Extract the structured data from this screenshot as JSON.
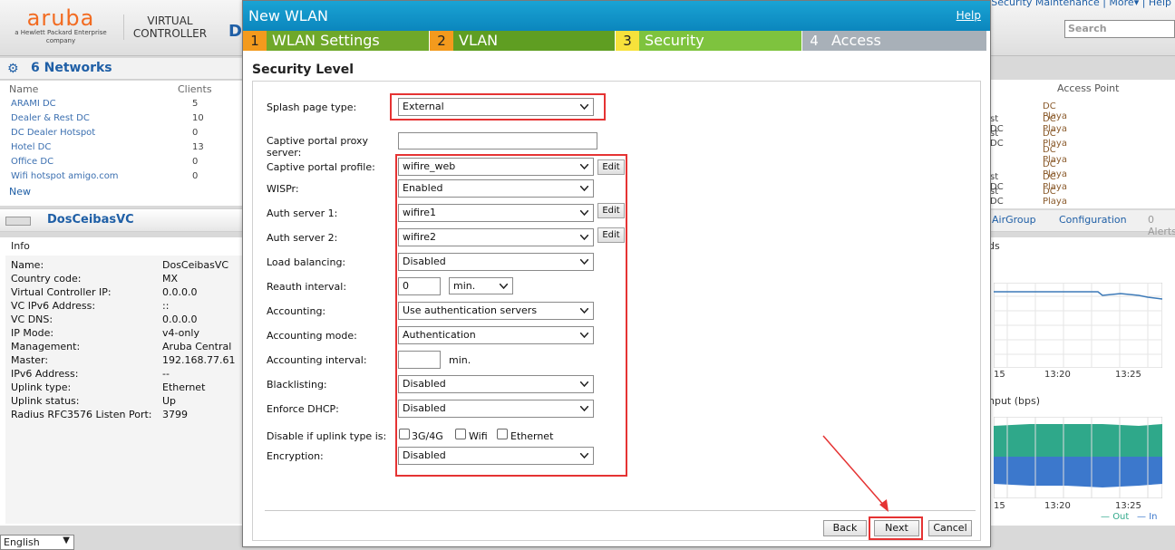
{
  "topbar": {
    "brand": "aruba",
    "brand_sub": "a Hewlett Packard Enterprise company",
    "vc_label_1": "VIRTUAL",
    "vc_label_2": "CONTROLLER",
    "vc_initial": "D",
    "links": "Security   Maintenance  |  More▾  |  Help",
    "search_placeholder": "Search"
  },
  "networks": {
    "title": "6 Networks",
    "col_name": "Name",
    "col_clients": "Clients",
    "rows": [
      {
        "name": "ARAMI DC",
        "clients": "5"
      },
      {
        "name": "Dealer & Rest DC",
        "clients": "10"
      },
      {
        "name": "DC Dealer Hotspot",
        "clients": "0"
      },
      {
        "name": "Hotel DC",
        "clients": "13"
      },
      {
        "name": "Office DC",
        "clients": "0"
      },
      {
        "name": "Wifi hotspot amigo.com",
        "clients": "0"
      }
    ],
    "new_label": "New"
  },
  "vc": {
    "title": "DosCeibasVC",
    "info_title": "Info",
    "info": [
      {
        "k": "Name:",
        "v": "DosCeibasVC"
      },
      {
        "k": "Country code:",
        "v": "MX"
      },
      {
        "k": "Virtual Controller IP:",
        "v": "0.0.0.0"
      },
      {
        "k": "VC IPv6 Address:",
        "v": "::"
      },
      {
        "k": "VC DNS:",
        "v": "0.0.0.0"
      },
      {
        "k": "IP Mode:",
        "v": "v4-only"
      },
      {
        "k": "Management:",
        "v": "Aruba Central"
      },
      {
        "k": "Master:",
        "v": "192.168.77.61"
      },
      {
        "k": "IPv6 Address:",
        "v": "--"
      },
      {
        "k": "Uplink type:",
        "v": "Ethernet"
      },
      {
        "k": "Uplink status:",
        "v": "Up"
      },
      {
        "k": "Radius RFC3576 Listen Port:",
        "v": "3799"
      }
    ]
  },
  "language": "English",
  "right_panel": {
    "col_ap": "Access Point",
    "rows": [
      {
        "a": "",
        "b": "DC Playa"
      },
      {
        "a": "st DC",
        "b": "DC Playa"
      },
      {
        "a": "st DC",
        "b": "DC Playa"
      },
      {
        "a": "",
        "b": "DC Playa"
      },
      {
        "a": "",
        "b": "DC Playa"
      },
      {
        "a": "st DC",
        "b": "DC Playa"
      },
      {
        "a": "st DC",
        "b": "DC Playa"
      }
    ],
    "tabs": [
      "AirGroup",
      "Configuration",
      "0 Alerts"
    ],
    "clients_label": "ds",
    "throughput_label": "hput   (bps)",
    "ticks_1": [
      "15",
      "13:20",
      "13:25"
    ],
    "ticks_2": [
      "15",
      "13:20",
      "13:25"
    ],
    "legend_out": "Out",
    "legend_in": "In"
  },
  "modal": {
    "title": "New WLAN",
    "help": "Help",
    "steps": [
      {
        "num": "1",
        "label": "WLAN Settings"
      },
      {
        "num": "2",
        "label": "VLAN"
      },
      {
        "num": "3",
        "label": "Security"
      },
      {
        "num": "4",
        "label": "Access"
      }
    ],
    "section_title": "Security Level",
    "fields": {
      "splash_label": "Splash page type:",
      "splash_value": "External",
      "proxy_label_1": "Captive portal proxy",
      "proxy_label_2": "server:",
      "proxy_value": "",
      "profile_label": "Captive portal profile:",
      "profile_value": "wifire_web",
      "wispr_label": "WISPr:",
      "wispr_value": "Enabled",
      "auth1_label": "Auth server 1:",
      "auth1_value": "wifire1",
      "auth2_label": "Auth server 2:",
      "auth2_value": "wifire2",
      "lb_label": "Load balancing:",
      "lb_value": "Disabled",
      "reauth_label": "Reauth interval:",
      "reauth_value": "0",
      "reauth_unit": "min.",
      "acct_label": "Accounting:",
      "acct_value": "Use authentication servers",
      "acct_mode_label": "Accounting mode:",
      "acct_mode_value": "Authentication",
      "acct_int_label": "Accounting interval:",
      "acct_int_value": "",
      "acct_int_unit": "min.",
      "blacklist_label": "Blacklisting:",
      "blacklist_value": "Disabled",
      "dhcp_label": "Enforce DHCP:",
      "dhcp_value": "Disabled",
      "uplink_label": "Disable if uplink type is:",
      "uplink_3g": "3G/4G",
      "uplink_wifi": "Wifi",
      "uplink_eth": "Ethernet",
      "enc_label": "Encryption:",
      "enc_value": "Disabled"
    },
    "edit_label": "Edit",
    "back": "Back",
    "next": "Next",
    "cancel": "Cancel"
  },
  "colors": {
    "step1": "#f39a1d",
    "step_green": "#6fa82a",
    "step3": "#f7e23b",
    "step3_label": "#7ec33e",
    "step4": "#a8b0b8",
    "title_bar": "#0e8fc6",
    "highlight": "#e53333"
  }
}
